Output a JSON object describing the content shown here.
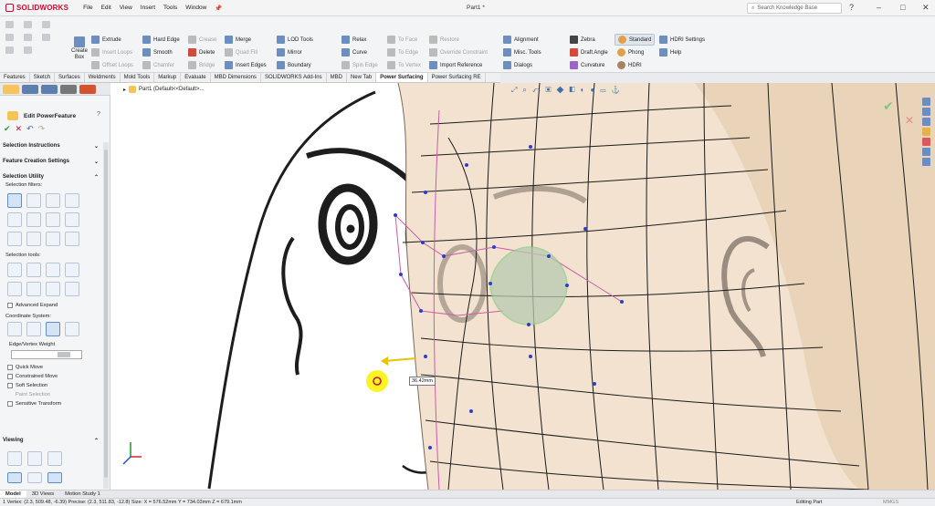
{
  "app": {
    "brand": "SOLIDWORKS",
    "document_title": "Part1 *"
  },
  "menu": [
    "File",
    "Edit",
    "View",
    "Insert",
    "Tools",
    "Window"
  ],
  "search": {
    "placeholder": "Search Knowledge Base"
  },
  "ribbon": {
    "create_box": "Create Box",
    "col1": [
      "Extrude",
      "Insert Loops",
      "Offset Loops"
    ],
    "col2": [
      "Hard Edge",
      "Smooth",
      "Chamfer"
    ],
    "col3": [
      "Crease",
      "Delete",
      "Bridge"
    ],
    "col4": [
      "Merge",
      "Quad Fill",
      "Insert Edges"
    ],
    "col5": [
      "LOD Tools",
      "Mirror",
      "Boundary"
    ],
    "col6": [
      "Relax",
      "Curve",
      "Spin Edge"
    ],
    "col7": [
      "To Face",
      "To Edge",
      "To Vertex"
    ],
    "col8": [
      "Restore",
      "Override Constraint",
      "Import Reference"
    ],
    "col9": [
      "Alignment",
      "Misc. Tools",
      "Dialogs"
    ],
    "col10": [
      "Zebra",
      "Draft Angle",
      "Curvature"
    ],
    "col11": [
      "Standard",
      "Phong",
      "HDRI"
    ],
    "col12": [
      "HDRI Settings",
      "Help"
    ]
  },
  "tabs": [
    "Features",
    "Sketch",
    "Surfaces",
    "Weldments",
    "Mold Tools",
    "Markup",
    "Evaluate",
    "MBD Dimensions",
    "SOLIDWORKS Add-Ins",
    "MBD",
    "New Tab",
    "Power Surfacing",
    "Power Surfacing RE"
  ],
  "active_tab": "Power Surfacing",
  "panel": {
    "title": "Edit PowerFeature",
    "sections": {
      "instructions": "Selection Instructions",
      "feature_settings": "Feature Creation Settings",
      "utility": "Selection Utility",
      "viewing": "Viewing"
    },
    "labels": {
      "filters": "Selection filters:",
      "tools": "Selection tools:",
      "coord": "Coordinate System:",
      "weight": "Edge/Vertex Weight"
    },
    "checkboxes": [
      "Advanced Expand",
      "Quick Move",
      "Constrained Move",
      "Soft Selection",
      "Paint Selection",
      "Sensitive Transform"
    ]
  },
  "tree": {
    "part_label": "Part1  (Default<<Default>..."
  },
  "callout": "36.42mm",
  "bottom_tabs": [
    "Model",
    "3D Views",
    "Motion Study 1"
  ],
  "active_bottom_tab": "Model",
  "status": {
    "left": "1 Vertex: (2.3, 509.48, -6.39) Precise: (2.3, 511.83, -12.8) Size: X = 576.52mm Y = 734.03mm Z = 679.1mm",
    "right": "Editing Part",
    "units": "MMGS"
  },
  "colors": {
    "accent": "#c8102e",
    "skin": "#f2e2cf",
    "mesh": "#1b1b1b",
    "cage": "#c95da8",
    "highlight": "#9fd39a"
  }
}
